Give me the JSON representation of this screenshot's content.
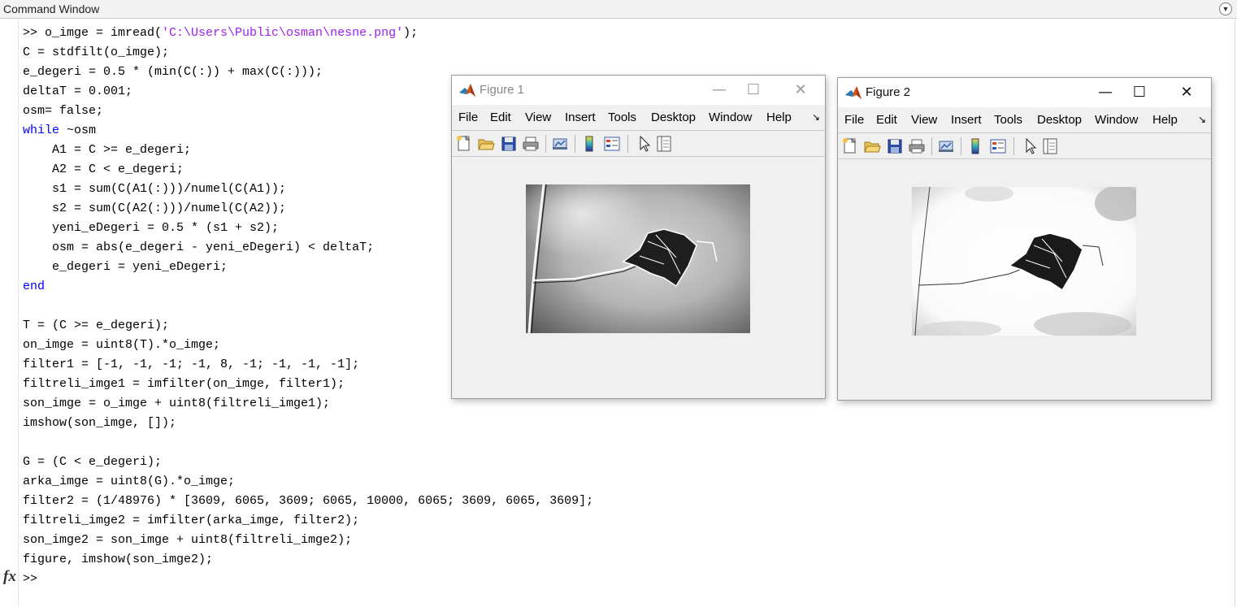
{
  "command_window": {
    "title": "Command Window",
    "menu_icon": "chevron-down-circle-icon",
    "code_lines": [
      [
        {
          "t": ">> o_imge = imread(",
          "c": ""
        },
        {
          "t": "'C:\\Users\\Public\\osman\\nesne.png'",
          "c": "str"
        },
        {
          "t": ");",
          "c": ""
        }
      ],
      [
        {
          "t": "C = stdfilt(o_imge);",
          "c": ""
        }
      ],
      [
        {
          "t": "e_degeri = 0.5 * (min(C(:)) + max(C(:)));",
          "c": ""
        }
      ],
      [
        {
          "t": "deltaT = 0.001;",
          "c": ""
        }
      ],
      [
        {
          "t": "osm= false;",
          "c": ""
        }
      ],
      [
        {
          "t": "while",
          "c": "kw"
        },
        {
          "t": " ~osm",
          "c": ""
        }
      ],
      [
        {
          "t": "    A1 = C >= e_degeri;",
          "c": ""
        }
      ],
      [
        {
          "t": "    A2 = C < e_degeri;",
          "c": ""
        }
      ],
      [
        {
          "t": "    s1 = sum(C(A1(:)))/numel(C(A1));",
          "c": ""
        }
      ],
      [
        {
          "t": "    s2 = sum(C(A2(:)))/numel(C(A2));",
          "c": ""
        }
      ],
      [
        {
          "t": "    yeni_eDegeri = 0.5 * (s1 + s2);",
          "c": ""
        }
      ],
      [
        {
          "t": "    osm = abs(e_degeri - yeni_eDegeri) < deltaT;",
          "c": ""
        }
      ],
      [
        {
          "t": "    e_degeri = yeni_eDegeri;",
          "c": ""
        }
      ],
      [
        {
          "t": "end",
          "c": "kw"
        }
      ],
      [
        {
          "t": "",
          "c": ""
        }
      ],
      [
        {
          "t": "T = (C >= e_degeri);",
          "c": ""
        }
      ],
      [
        {
          "t": "on_imge = uint8(T).*o_imge;",
          "c": ""
        }
      ],
      [
        {
          "t": "filter1 = [-1, -1, -1; -1, 8, -1; -1, -1, -1];",
          "c": ""
        }
      ],
      [
        {
          "t": "filtreli_imge1 = imfilter(on_imge, filter1);",
          "c": ""
        }
      ],
      [
        {
          "t": "son_imge = o_imge + uint8(filtreli_imge1);",
          "c": ""
        }
      ],
      [
        {
          "t": "imshow(son_imge, []);",
          "c": ""
        }
      ],
      [
        {
          "t": "",
          "c": ""
        }
      ],
      [
        {
          "t": "G = (C < e_degeri);",
          "c": ""
        }
      ],
      [
        {
          "t": "arka_imge = uint8(G).*o_imge;",
          "c": ""
        }
      ],
      [
        {
          "t": "filter2 = (1/48976) * [3609, 6065, 3609; 6065, 10000, 6065; 3609, 6065, 3609];",
          "c": ""
        }
      ],
      [
        {
          "t": "filtreli_imge2 = imfilter(arka_imge, filter2);",
          "c": ""
        }
      ],
      [
        {
          "t": "son_imge2 = son_imge + uint8(filtreli_imge2);",
          "c": ""
        }
      ],
      [
        {
          "t": "figure, imshow(son_imge2);",
          "c": ""
        }
      ]
    ],
    "fx_label": "fx",
    "prompt": ">>"
  },
  "colors": {
    "keyword": "#0000ff",
    "string": "#a020f0",
    "figure_bg": "#f0f0f0"
  },
  "figure1": {
    "title": "Figure 1",
    "minimize": "—",
    "maximize": "☐",
    "close": "✕",
    "menu": [
      "File",
      "Edit",
      "View",
      "Insert",
      "Tools",
      "Desktop",
      "Window",
      "Help"
    ],
    "menu_more": "↘",
    "toolbar_icons": [
      "new-figure-icon",
      "open-folder-icon",
      "save-icon",
      "print-icon",
      "link-plot-icon",
      "colorbar-icon",
      "legend-icon",
      "pointer-icon",
      "property-inspector-icon"
    ],
    "image_desc_icon": "grayscale-image-with-edges"
  },
  "figure2": {
    "title": "Figure 2",
    "minimize": "—",
    "maximize": "☐",
    "close": "✕",
    "menu": [
      "File",
      "Edit",
      "View",
      "Insert",
      "Tools",
      "Desktop",
      "Window",
      "Help"
    ],
    "menu_more": "↘",
    "toolbar_icons": [
      "new-figure-icon",
      "open-folder-icon",
      "save-icon",
      "print-icon",
      "link-plot-icon",
      "colorbar-icon",
      "legend-icon",
      "pointer-icon",
      "property-inspector-icon"
    ],
    "image_desc_icon": "white-background-image-with-edges"
  }
}
